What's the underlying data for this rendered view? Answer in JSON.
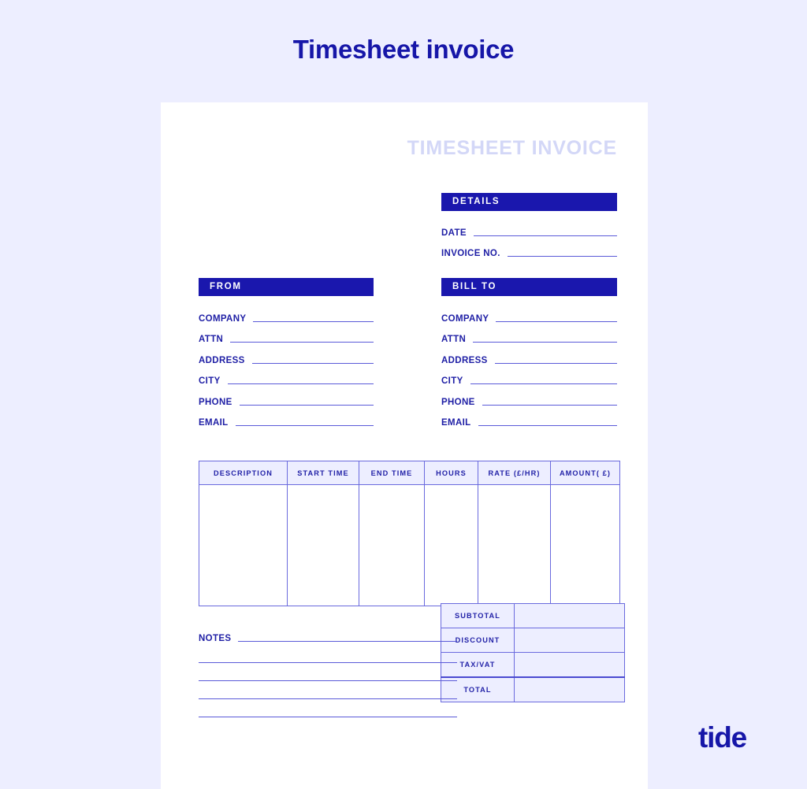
{
  "page": {
    "heading": "Timesheet invoice",
    "background_color": "#edeeff",
    "accent_color": "#1a17ad"
  },
  "document": {
    "watermark_title": "TIMESHEET INVOICE",
    "details": {
      "header": "DETAILS",
      "fields": [
        {
          "label": "DATE",
          "value": ""
        },
        {
          "label": "INVOICE NO.",
          "value": ""
        }
      ]
    },
    "from": {
      "header": "FROM",
      "fields": [
        {
          "label": "COMPANY",
          "value": ""
        },
        {
          "label": "ATTN",
          "value": ""
        },
        {
          "label": "ADDRESS",
          "value": ""
        },
        {
          "label": "CITY",
          "value": ""
        },
        {
          "label": "PHONE",
          "value": ""
        },
        {
          "label": "EMAIL",
          "value": ""
        }
      ]
    },
    "bill_to": {
      "header": "BILL TO",
      "fields": [
        {
          "label": "COMPANY",
          "value": ""
        },
        {
          "label": "ATTN",
          "value": ""
        },
        {
          "label": "ADDRESS",
          "value": ""
        },
        {
          "label": "CITY",
          "value": ""
        },
        {
          "label": "PHONE",
          "value": ""
        },
        {
          "label": "EMAIL",
          "value": ""
        }
      ]
    },
    "line_items": {
      "columns": [
        "DESCRIPTION",
        "START TIME",
        "END TIME",
        "HOURS",
        "RATE (£/HR)",
        "AMOUNT( £)"
      ],
      "rows": []
    },
    "totals": [
      {
        "label": "SUBTOTAL",
        "value": ""
      },
      {
        "label": "DISCOUNT",
        "value": ""
      },
      {
        "label": "TAX/VAT",
        "value": ""
      },
      {
        "label": "TOTAL",
        "value": ""
      }
    ],
    "notes": {
      "label": "NOTES",
      "lines": [
        "",
        "",
        "",
        ""
      ]
    }
  },
  "footer": {
    "logo_text": "tide"
  }
}
